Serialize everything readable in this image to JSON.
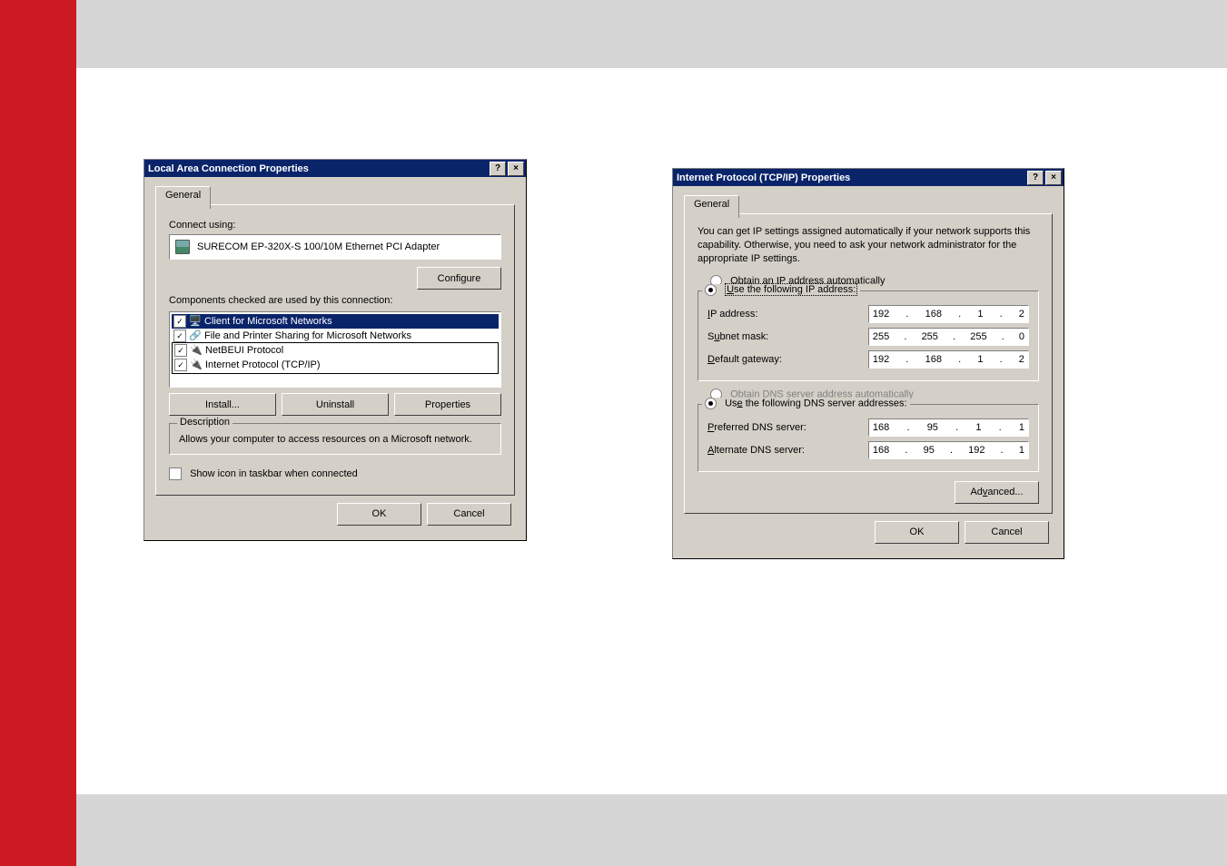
{
  "common": {
    "ok": "OK",
    "cancel": "Cancel"
  },
  "lac": {
    "title": "Local Area Connection Properties",
    "tab": "General",
    "connect_label": "Connect using:",
    "adapter": "SURECOM EP-320X-S 100/10M Ethernet PCI Adapter",
    "configure": "Configure",
    "components_label": "Components checked are used by this connection:",
    "components": [
      "Client for Microsoft Networks",
      "File and Printer Sharing for Microsoft Networks",
      "NetBEUI Protocol",
      "Internet Protocol (TCP/IP)"
    ],
    "install": "Install...",
    "uninstall": "Uninstall",
    "properties": "Properties",
    "desc_legend": "Description",
    "description": "Allows your computer to access resources on a Microsoft network.",
    "show_icon": "Show icon in taskbar when connected"
  },
  "tcpip": {
    "title": "Internet Protocol (TCP/IP) Properties",
    "tab": "General",
    "intro": "You can get IP settings assigned automatically if your network supports this capability. Otherwise, you need to ask your network administrator for the appropriate IP settings.",
    "obtain_ip_u": "O",
    "obtain_ip": "btain an IP address automatically",
    "use_ip_u": "U",
    "use_ip": "se the following IP address:",
    "ip_u": "I",
    "ip_label": "P address:",
    "ip": [
      "192",
      "168",
      "1",
      "2"
    ],
    "mask_u": "u",
    "mask_label": "bnet mask:",
    "mask": [
      "255",
      "255",
      "255",
      "0"
    ],
    "gw_u": "D",
    "gw_label": "efault gateway:",
    "gw": [
      "192",
      "168",
      "1",
      "2"
    ],
    "obtain_dns_u": "b",
    "obtain_dns": "tain DNS server address automatically",
    "use_dns_u": "e",
    "use_dns": " the following DNS server addresses:",
    "pdns_u": "P",
    "pdns_label": "referred DNS server:",
    "pdns": [
      "168",
      "95",
      "1",
      "1"
    ],
    "adns_u": "A",
    "adns_label": "lternate DNS server:",
    "adns": [
      "168",
      "95",
      "192",
      "1"
    ],
    "advanced_u": "v",
    "advanced": "anced..."
  }
}
